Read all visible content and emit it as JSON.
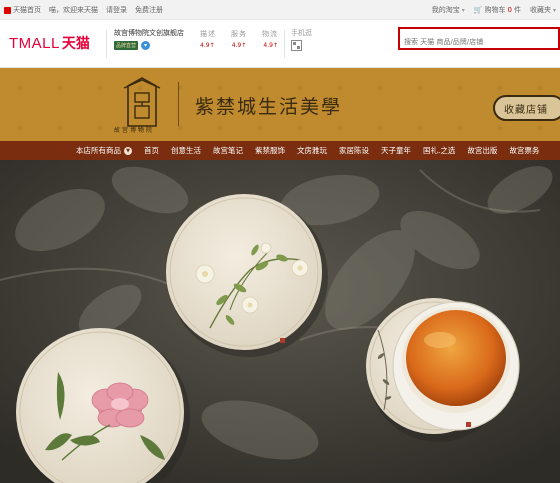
{
  "topbar": {
    "home": "天猫首页",
    "greeting": "喵，欢迎来天猫",
    "login": "请登录",
    "register": "免费注册",
    "my_taobao": "我的淘宝",
    "cart_label": "购物车",
    "cart_count": "0",
    "cart_unit": "件",
    "favorites": "收藏夹"
  },
  "header": {
    "logo_text": "TMALL",
    "logo_cn": "天猫",
    "shop_name": "故宫博物院文创旗舰店",
    "shop_badge": "品牌直营",
    "rating_labels": [
      "描述",
      "服务",
      "物流"
    ],
    "rating_values": [
      "4.9",
      "4.9",
      "4.9"
    ],
    "mobile_label": "手机逛",
    "search_placeholder": "搜索 天猫 商品/品牌/店铺"
  },
  "banner": {
    "emblem_caption": "故宫博物院",
    "title": "紫禁城生活美學",
    "collect_button": "收藏店铺",
    "colors": {
      "gold": "#bf8b2e",
      "dark": "#3a2a10"
    }
  },
  "nav": {
    "items": [
      "本店所有商品",
      "首页",
      "创意生活",
      "故宫笔记",
      "紫禁服饰",
      "文房雅玩",
      "家居陈设",
      "天子童年",
      "国礼.之选",
      "故宫出版",
      "故宫票务"
    ],
    "bar_color": "#7a2d0f"
  },
  "hero": {
    "products": [
      "peony-coaster",
      "rose-coaster",
      "tea-cup"
    ]
  }
}
